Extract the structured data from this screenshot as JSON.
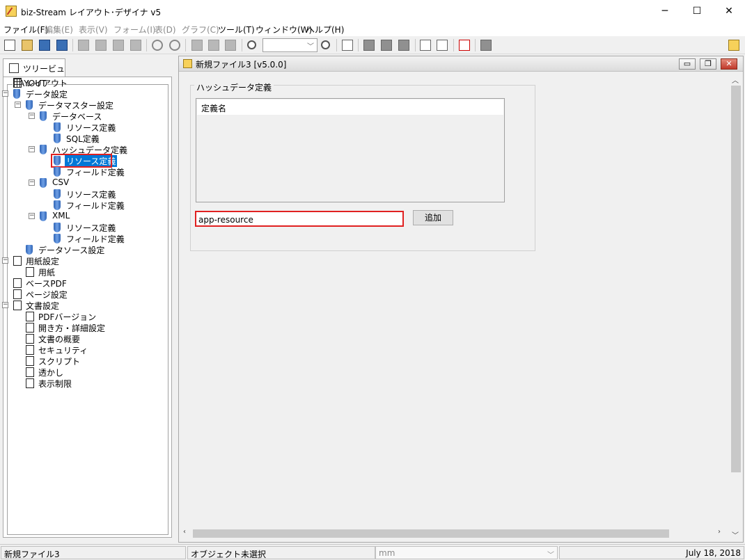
{
  "window": {
    "title": "biz-Stream レイアウト･デザイナ v5",
    "minimize": "─",
    "maximize": "☐",
    "close": "✕"
  },
  "menu": [
    {
      "label": "ファイル(F)",
      "enabled": true
    },
    {
      "label": "編集(E)",
      "enabled": false
    },
    {
      "label": "表示(V)",
      "enabled": false
    },
    {
      "label": "フォーム(I)",
      "enabled": false
    },
    {
      "label": "表(D)",
      "enabled": false
    },
    {
      "label": "グラフ(C)",
      "enabled": false
    },
    {
      "label": "ツール(T)",
      "enabled": true
    },
    {
      "label": "ウィンドウ(W)",
      "enabled": true
    },
    {
      "label": "ヘルプ(H)",
      "enabled": true
    }
  ],
  "toolbar": {
    "zoom_value": "",
    "icons": [
      "new-document-icon",
      "open-folder-icon",
      "save-icon",
      "save-all-icon",
      "copy-icon",
      "cut-icon",
      "paste-icon",
      "delete-icon",
      "undo-icon",
      "redo-icon",
      "page-icon",
      "page2-icon",
      "page3-icon",
      "zoom-in-icon",
      "zoom-out-icon",
      "edit-icon",
      "grid-icon",
      "properties-icon",
      "table-icon",
      "preview-icon",
      "find-icon",
      "tools-icon",
      "stop-icon",
      "memo-icon"
    ]
  },
  "left_pane": {
    "tab_label": "ツリービュー",
    "group_label": "LAYOUT",
    "tree": [
      {
        "label": "レイアウト",
        "icon": "grid",
        "level": 0
      },
      {
        "label": "データ設定",
        "icon": "db",
        "level": 0
      },
      {
        "label": "データマスター設定",
        "icon": "db",
        "level": 1
      },
      {
        "label": "データベース",
        "icon": "db",
        "level": 2
      },
      {
        "label": "リソース定義",
        "icon": "db",
        "level": 3
      },
      {
        "label": "SQL定義",
        "icon": "db",
        "level": 3
      },
      {
        "label": "ハッシュデータ定義",
        "icon": "db",
        "level": 2
      },
      {
        "label": "リソース定義",
        "icon": "db",
        "level": 3,
        "selected": true
      },
      {
        "label": "フィールド定義",
        "icon": "db",
        "level": 3
      },
      {
        "label": "CSV",
        "icon": "db",
        "level": 2
      },
      {
        "label": "リソース定義",
        "icon": "db",
        "level": 3
      },
      {
        "label": "フィールド定義",
        "icon": "db",
        "level": 3
      },
      {
        "label": "XML",
        "icon": "db",
        "level": 2
      },
      {
        "label": "リソース定義",
        "icon": "db",
        "level": 3
      },
      {
        "label": "フィールド定義",
        "icon": "db",
        "level": 3
      },
      {
        "label": "データソース設定",
        "icon": "db",
        "level": 1
      },
      {
        "label": "用紙設定",
        "icon": "pg",
        "level": 0
      },
      {
        "label": "用紙",
        "icon": "pg",
        "level": 1
      },
      {
        "label": "ベースPDF",
        "icon": "pg",
        "level": 0
      },
      {
        "label": "ページ設定",
        "icon": "pg",
        "level": 0
      },
      {
        "label": "文書設定",
        "icon": "pg",
        "level": 0
      },
      {
        "label": "PDFバージョン",
        "icon": "pg",
        "level": 1
      },
      {
        "label": "開き方・詳細設定",
        "icon": "pg",
        "level": 1
      },
      {
        "label": "文書の概要",
        "icon": "pg",
        "level": 1
      },
      {
        "label": "セキュリティ",
        "icon": "pg",
        "level": 1
      },
      {
        "label": "スクリプト",
        "icon": "pg",
        "level": 1
      },
      {
        "label": "透かし",
        "icon": "pg",
        "level": 1
      },
      {
        "label": "表示制限",
        "icon": "pg",
        "level": 1
      }
    ]
  },
  "child_window": {
    "title": "新規ファイル3 [v5.0.0]",
    "group_label": "ハッシュデータ定義",
    "list_header": "定義名",
    "input_value": "app-resource",
    "add_button": "追加",
    "btn_min": "▭",
    "btn_restore": "❐",
    "btn_close": "✕"
  },
  "statusbar": {
    "file": "新規ファイル3",
    "selection": "オブジェクト未選択",
    "unit": "mm",
    "date": "July 18, 2018"
  }
}
